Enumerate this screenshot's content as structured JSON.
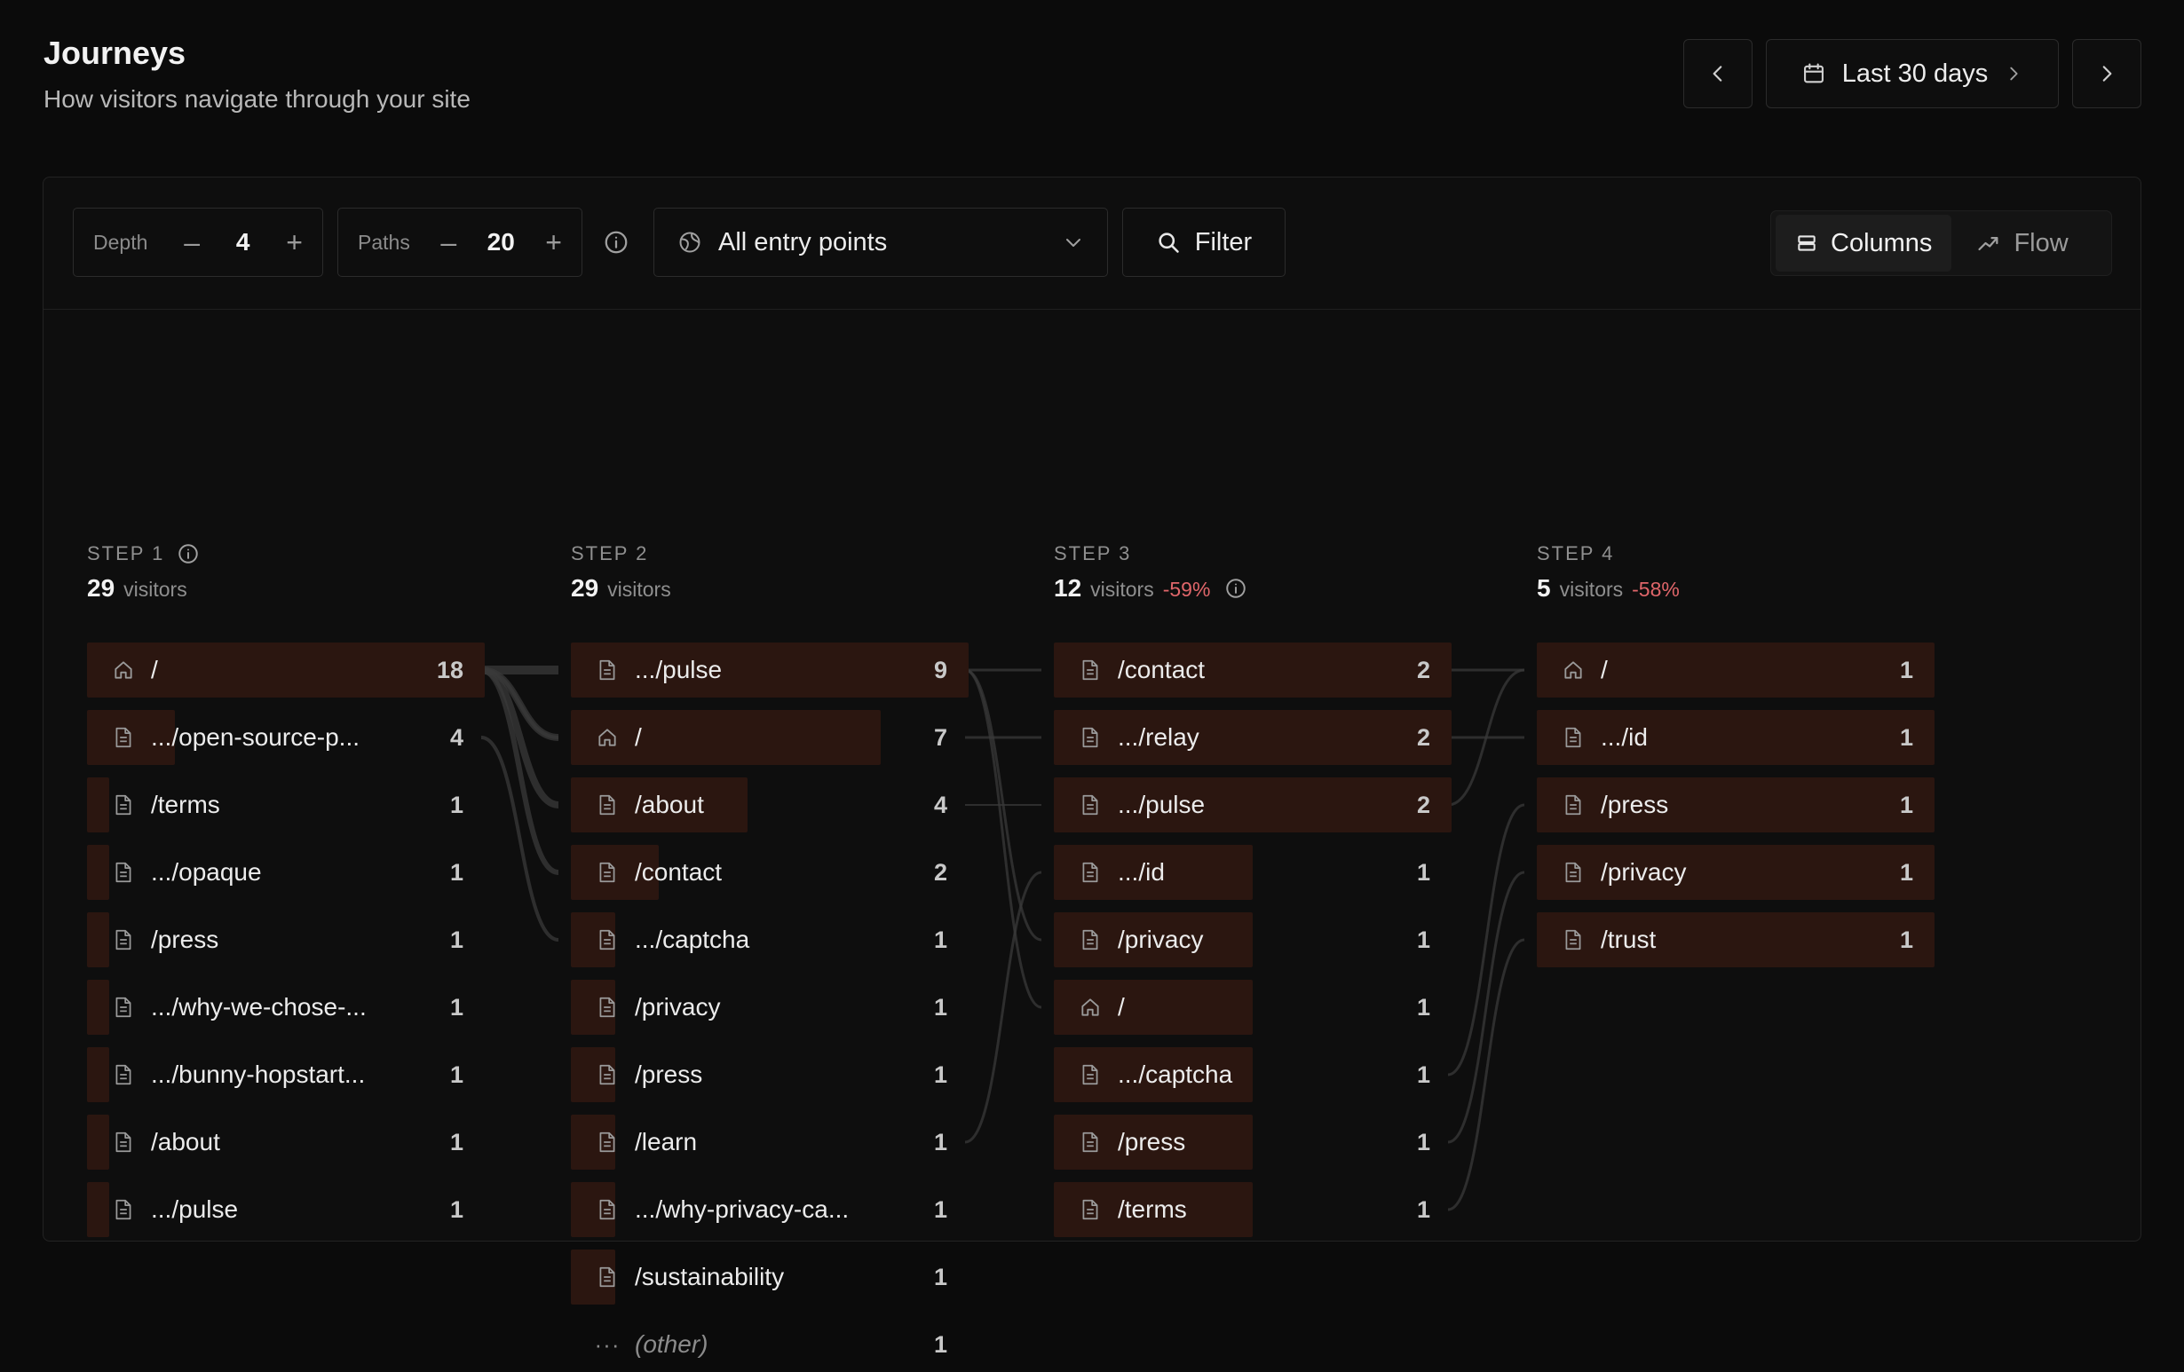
{
  "header": {
    "title": "Journeys",
    "subtitle": "How visitors navigate through your site"
  },
  "date_range": {
    "label": "Last 30 days"
  },
  "toolbar": {
    "depth_label": "Depth",
    "depth_value": "4",
    "paths_label": "Paths",
    "paths_value": "20",
    "entry_select": "All entry points",
    "filter_label": "Filter",
    "view_columns": "Columns",
    "view_flow": "Flow"
  },
  "steps": [
    {
      "label": "STEP 1",
      "visitors": "29",
      "visitors_label": "visitors",
      "drop": "",
      "rows": [
        {
          "path": "/",
          "count": "18",
          "icon": "home-icon",
          "bar": 1.0
        },
        {
          "path": ".../open-source-p...",
          "count": "4",
          "icon": "page-icon",
          "bar": 0.222
        },
        {
          "path": "/terms",
          "count": "1",
          "icon": "page-icon",
          "bar": 0.056
        },
        {
          "path": ".../opaque",
          "count": "1",
          "icon": "page-icon",
          "bar": 0.056
        },
        {
          "path": "/press",
          "count": "1",
          "icon": "page-icon",
          "bar": 0.056
        },
        {
          "path": ".../why-we-chose-...",
          "count": "1",
          "icon": "page-icon",
          "bar": 0.056
        },
        {
          "path": ".../bunny-hopstart...",
          "count": "1",
          "icon": "page-icon",
          "bar": 0.056
        },
        {
          "path": "/about",
          "count": "1",
          "icon": "page-icon",
          "bar": 0.056
        },
        {
          "path": ".../pulse",
          "count": "1",
          "icon": "page-icon",
          "bar": 0.056
        }
      ]
    },
    {
      "label": "STEP 2",
      "visitors": "29",
      "visitors_label": "visitors",
      "drop": "",
      "rows": [
        {
          "path": ".../pulse",
          "count": "9",
          "icon": "page-icon",
          "bar": 1.0
        },
        {
          "path": "/",
          "count": "7",
          "icon": "home-icon",
          "bar": 0.778
        },
        {
          "path": "/about",
          "count": "4",
          "icon": "page-icon",
          "bar": 0.444
        },
        {
          "path": "/contact",
          "count": "2",
          "icon": "page-icon",
          "bar": 0.222
        },
        {
          "path": ".../captcha",
          "count": "1",
          "icon": "page-icon",
          "bar": 0.111
        },
        {
          "path": "/privacy",
          "count": "1",
          "icon": "page-icon",
          "bar": 0.111
        },
        {
          "path": "/press",
          "count": "1",
          "icon": "page-icon",
          "bar": 0.111
        },
        {
          "path": "/learn",
          "count": "1",
          "icon": "page-icon",
          "bar": 0.111
        },
        {
          "path": ".../why-privacy-ca...",
          "count": "1",
          "icon": "page-icon",
          "bar": 0.111
        },
        {
          "path": "/sustainability",
          "count": "1",
          "icon": "page-icon",
          "bar": 0.111
        },
        {
          "path": "(other)",
          "count": "1",
          "icon": "more-icon",
          "bar": 0
        }
      ]
    },
    {
      "label": "STEP 3",
      "visitors": "12",
      "visitors_label": "visitors",
      "drop": "-59%",
      "rows": [
        {
          "path": "/contact",
          "count": "2",
          "icon": "page-icon",
          "bar": 1.0
        },
        {
          "path": ".../relay",
          "count": "2",
          "icon": "page-icon",
          "bar": 1.0
        },
        {
          "path": ".../pulse",
          "count": "2",
          "icon": "page-icon",
          "bar": 1.0
        },
        {
          "path": ".../id",
          "count": "1",
          "icon": "page-icon",
          "bar": 0.5
        },
        {
          "path": "/privacy",
          "count": "1",
          "icon": "page-icon",
          "bar": 0.5
        },
        {
          "path": "/",
          "count": "1",
          "icon": "home-icon",
          "bar": 0.5
        },
        {
          "path": ".../captcha",
          "count": "1",
          "icon": "page-icon",
          "bar": 0.5
        },
        {
          "path": "/press",
          "count": "1",
          "icon": "page-icon",
          "bar": 0.5
        },
        {
          "path": "/terms",
          "count": "1",
          "icon": "page-icon",
          "bar": 0.5
        }
      ]
    },
    {
      "label": "STEP 4",
      "visitors": "5",
      "visitors_label": "visitors",
      "drop": "-58%",
      "rows": [
        {
          "path": "/",
          "count": "1",
          "icon": "home-icon",
          "bar": 1.0
        },
        {
          "path": ".../id",
          "count": "1",
          "icon": "page-icon",
          "bar": 1.0
        },
        {
          "path": "/press",
          "count": "1",
          "icon": "page-icon",
          "bar": 1.0
        },
        {
          "path": "/privacy",
          "count": "1",
          "icon": "page-icon",
          "bar": 1.0
        },
        {
          "path": "/trust",
          "count": "1",
          "icon": "page-icon",
          "bar": 1.0
        }
      ]
    }
  ],
  "colors": {
    "bar": "#2b1610",
    "drop": "#e0666a",
    "link": "#3a3a3a"
  }
}
